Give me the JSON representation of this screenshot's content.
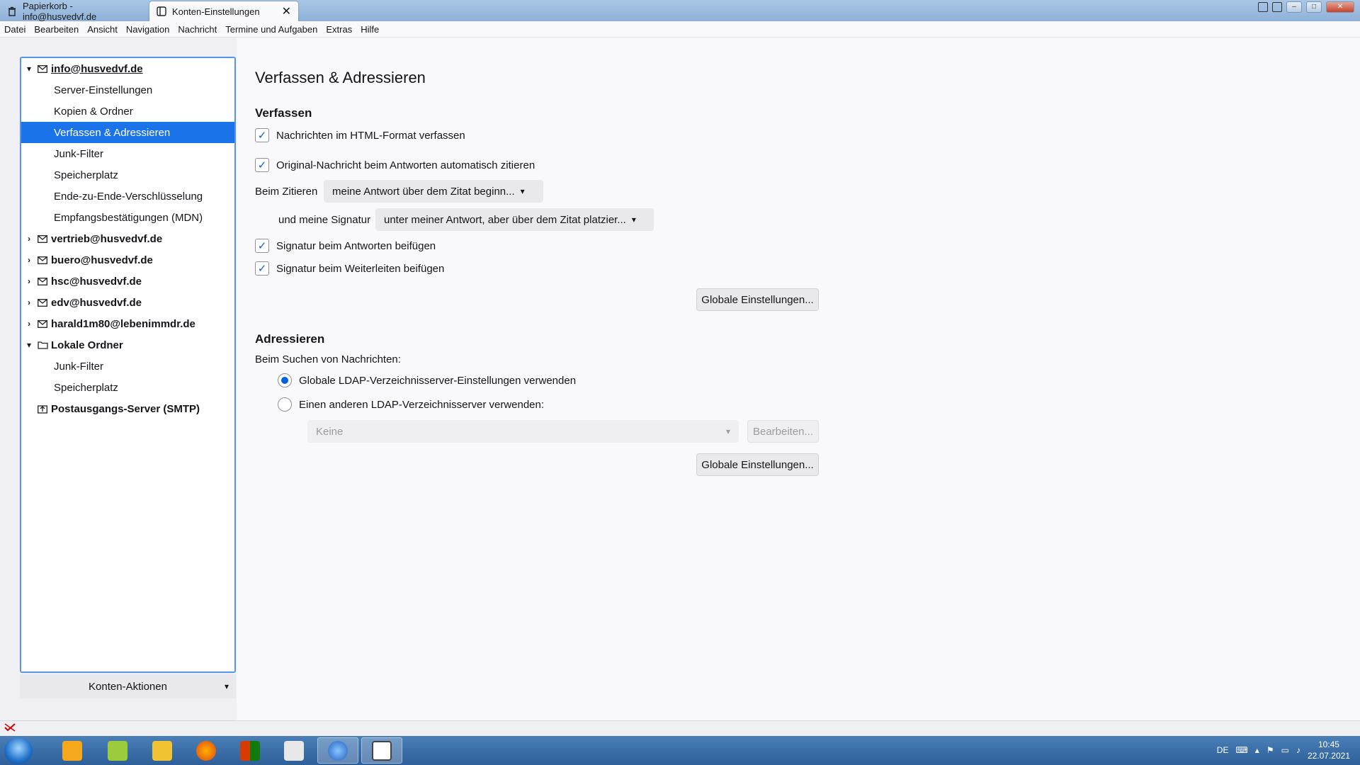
{
  "tabs": [
    {
      "label": "Papierkorb - info@husvedvf.de",
      "icon": "trash-icon"
    },
    {
      "label": "Konten-Einstellungen",
      "icon": "settings-page-icon",
      "close": "✕"
    }
  ],
  "menu": [
    "Datei",
    "Bearbeiten",
    "Ansicht",
    "Navigation",
    "Nachricht",
    "Termine und Aufgaben",
    "Extras",
    "Hilfe"
  ],
  "sidebar": {
    "accounts": [
      {
        "name": "info@husvedvf.de",
        "expanded": true,
        "items": [
          "Server-Einstellungen",
          "Kopien & Ordner",
          "Verfassen & Adressieren",
          "Junk-Filter",
          "Speicherplatz",
          "Ende-zu-Ende-Verschlüsselung",
          "Empfangsbestätigungen (MDN)"
        ]
      },
      {
        "name": "vertrieb@husvedvf.de",
        "expanded": false
      },
      {
        "name": "buero@husvedvf.de",
        "expanded": false
      },
      {
        "name": "hsc@husvedvf.de",
        "expanded": false
      },
      {
        "name": "edv@husvedvf.de",
        "expanded": false
      },
      {
        "name": "harald1m80@lebenimmdr.de",
        "expanded": false
      },
      {
        "name": "Lokale Ordner",
        "expanded": true,
        "items": [
          "Junk-Filter",
          "Speicherplatz"
        ]
      },
      {
        "name": "Postausgangs-Server (SMTP)"
      }
    ],
    "selected": "Verfassen & Adressieren",
    "actions_label": "Konten-Aktionen"
  },
  "main": {
    "title": "Verfassen & Adressieren",
    "compose": {
      "heading": "Verfassen",
      "html_format": {
        "label": "Nachrichten im HTML-Format verfassen",
        "checked": true
      },
      "auto_quote": {
        "label": "Original-Nachricht beim Antworten automatisch zitieren",
        "checked": true
      },
      "quote_label": "Beim Zitieren",
      "quote_value": "meine Antwort über dem Zitat beginn...",
      "signature_label": "und meine Signatur",
      "signature_value": "unter meiner Antwort, aber über dem Zitat platzier...",
      "sig_reply": {
        "label": "Signatur beim Antworten beifügen",
        "checked": true
      },
      "sig_forward": {
        "label": "Signatur beim Weiterleiten beifügen",
        "checked": true
      },
      "global_button": "Globale Einstellungen..."
    },
    "address": {
      "heading": "Adressieren",
      "search_label": "Beim Suchen von Nachrichten:",
      "radio_global": {
        "label": "Globale LDAP-Verzeichnisserver-Einstellungen verwenden",
        "checked": true
      },
      "radio_other": {
        "label": "Einen anderen LDAP-Verzeichnisserver verwenden:",
        "checked": false
      },
      "ldap_select": "Keine",
      "edit_button": "Bearbeiten...",
      "global_button": "Globale Einstellungen..."
    }
  },
  "taskbar": {
    "lang": "DE",
    "time": "10:45",
    "date": "22.07.2021"
  },
  "colors": {
    "accent": "#1a73e8",
    "checkbox": "#0061e0",
    "taskbar": "#2e5f99"
  }
}
